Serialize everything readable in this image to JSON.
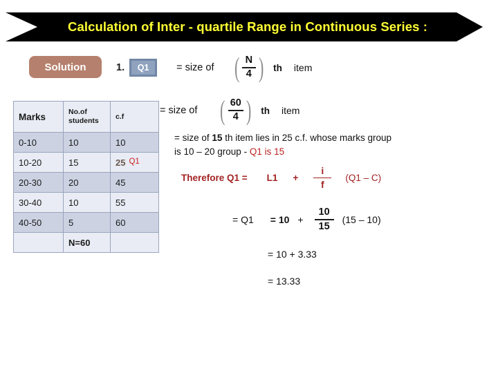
{
  "slide": {
    "title": "Calculation of  Inter - quartile Range in Continuous Series :",
    "title_color": "#ffff33",
    "banner_color": "#000000"
  },
  "solution": {
    "label": "Solution",
    "pill_color": "#b5806d"
  },
  "formula_line_1": {
    "step_number": "1.",
    "quartile_chip": "Q1",
    "chip_color": "#8fa3bf",
    "equals_text": "= size of",
    "fraction_numerator": "N",
    "fraction_denominator": "4",
    "th_label": "th",
    "item_label": "item"
  },
  "formula_line_2": {
    "equals_text": "= size of",
    "fraction_numerator": "60",
    "fraction_denominator": "4",
    "th_label": "th",
    "item_label": "item"
  },
  "table": {
    "columns": [
      "Marks",
      "No.of students",
      "c.f"
    ],
    "rows": [
      {
        "marks": "0-10",
        "students": "10",
        "cf": "10"
      },
      {
        "marks": "10-20",
        "students": "15",
        "cf": "25",
        "cf_tag": "Q1"
      },
      {
        "marks": "20-30",
        "students": "20",
        "cf": "45"
      },
      {
        "marks": "30-40",
        "students": "10",
        "cf": "55"
      },
      {
        "marks": "40-50",
        "students": "5",
        "cf": "60"
      }
    ],
    "total_row": {
      "marks": "",
      "students": "N=60",
      "cf": ""
    },
    "tag_color": "#cc2222"
  },
  "explanation": {
    "line_1_a": "= size of ",
    "line_1_bold": "15",
    "line_1_b": " th item  lies in 25 c.f. whose marks group",
    "line_2_a": "is 10 – 20 group  - ",
    "line_2_red": "Q1 is 15"
  },
  "therefore": {
    "lead": "Therefore Q1 =",
    "l1": "L1",
    "plus": "+",
    "frac_numerator": "i",
    "frac_denominator": "f",
    "tail": "(Q1 – C)",
    "color": "#a32222"
  },
  "numeric": {
    "eq_q1": "= Q1",
    "eq_value": "= 10",
    "plus": "+",
    "frac_numerator": "10",
    "frac_denominator": "15",
    "paren": "(15 – 10)"
  },
  "results": {
    "line_1": "= 10 + 3.33",
    "line_2": "= 13.33"
  }
}
